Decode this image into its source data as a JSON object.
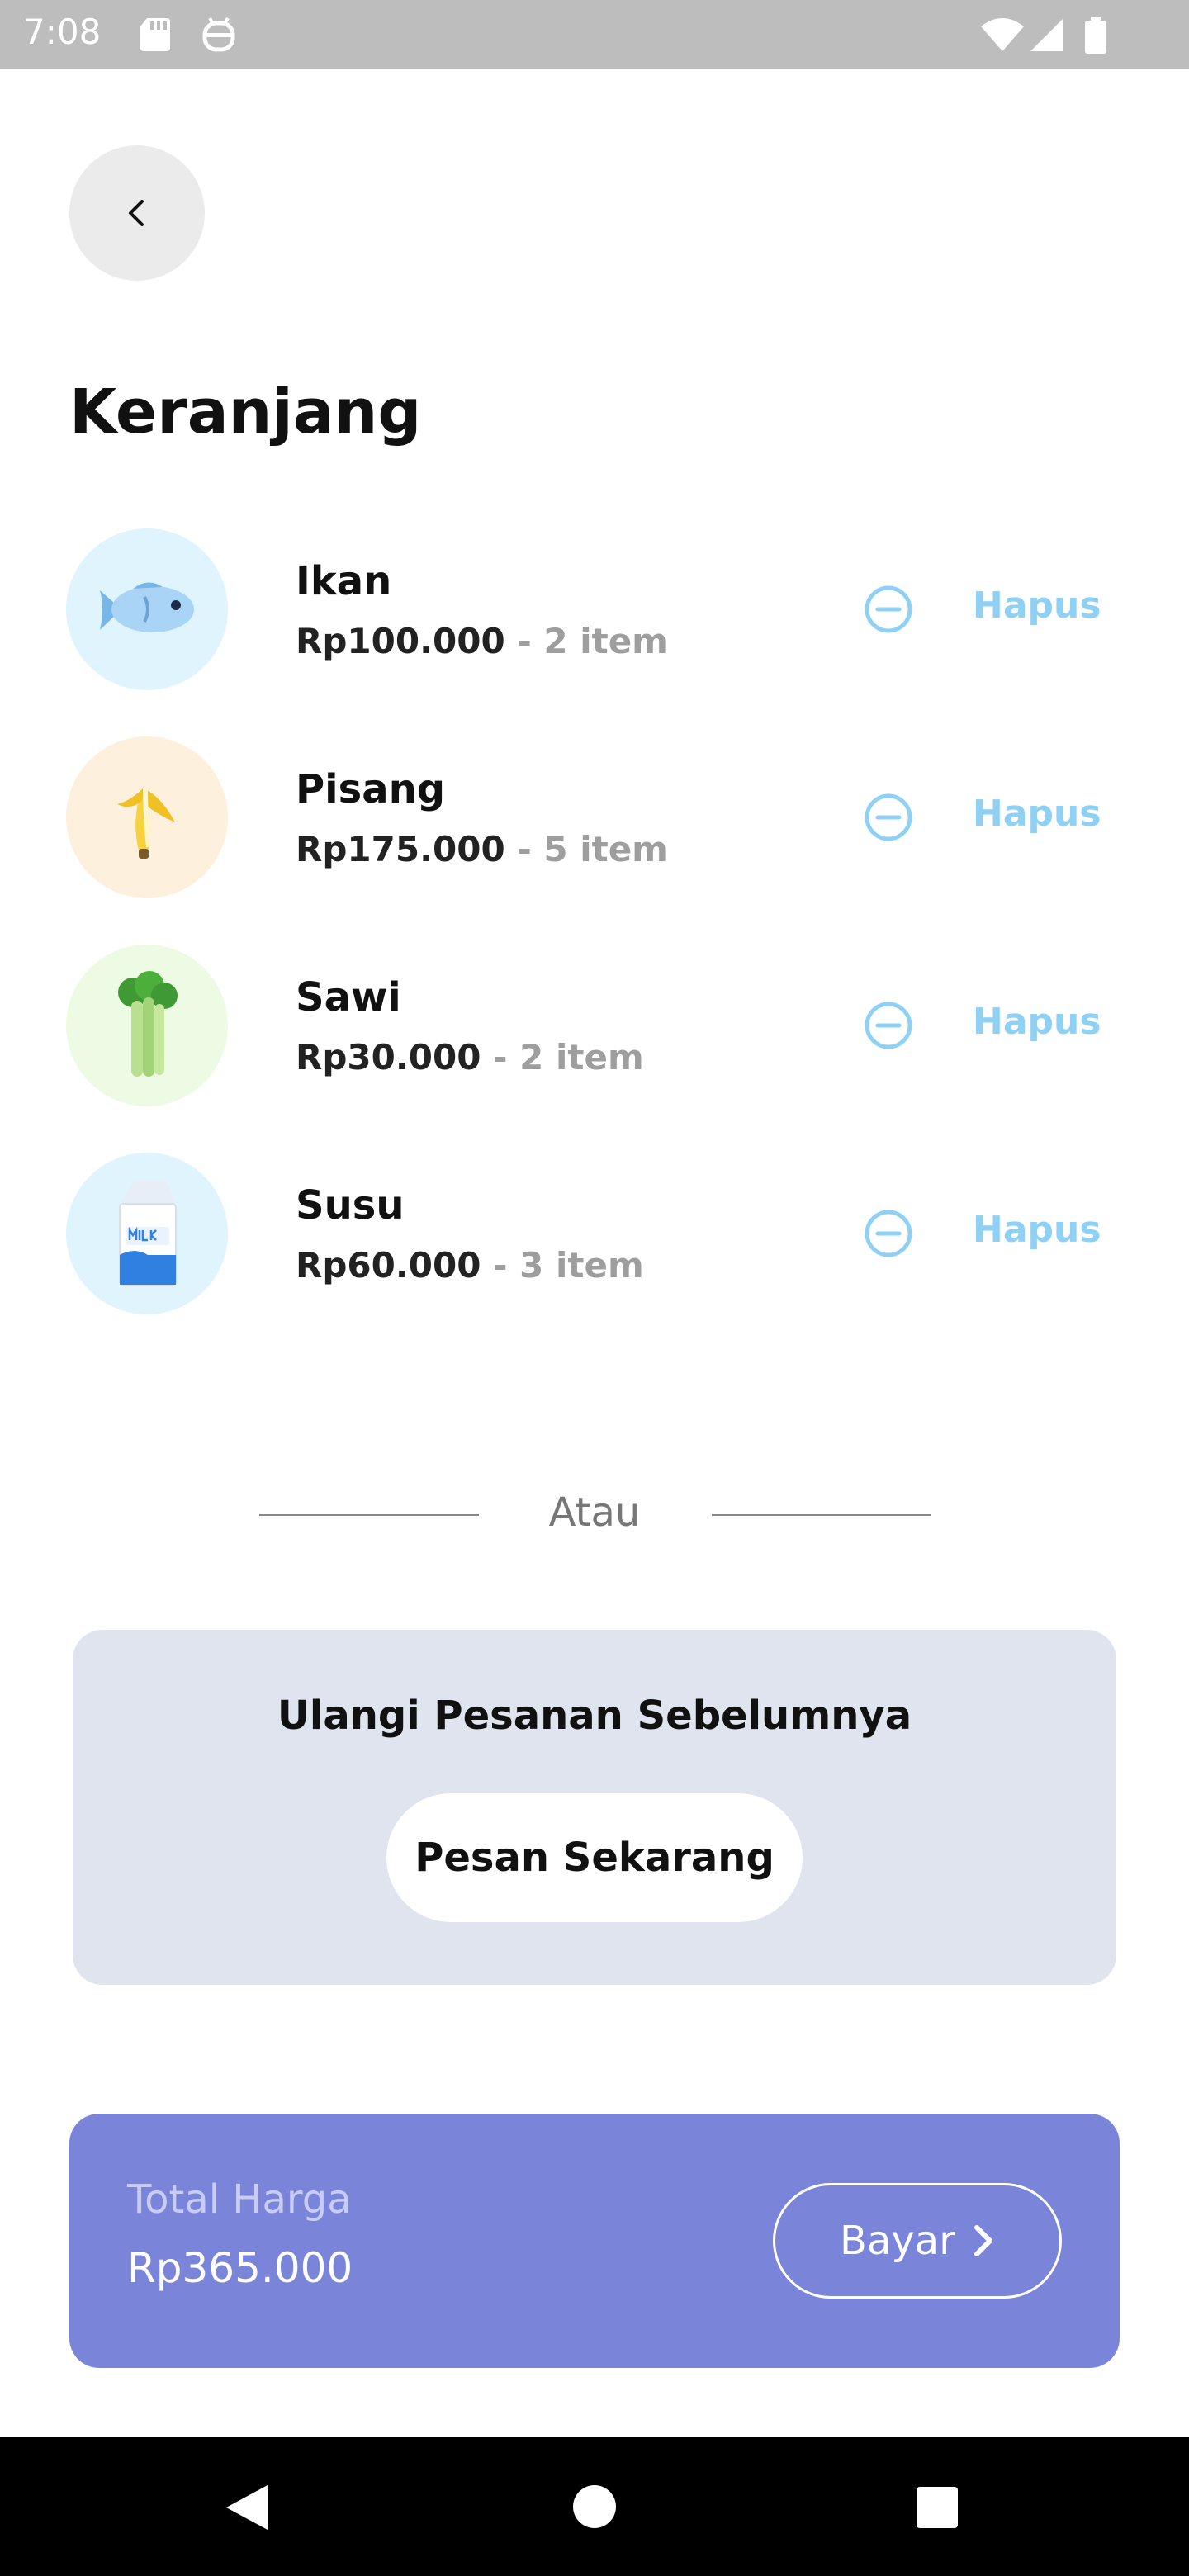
{
  "status_bar": {
    "time": "7:08"
  },
  "header": {
    "title": "Keranjang"
  },
  "cart": {
    "items": [
      {
        "name": "Ikan",
        "price": "Rp100.000",
        "qty": " - 2 item",
        "remove_label": "Hapus",
        "icon": "fish-icon",
        "bg": "#dff4fd"
      },
      {
        "name": "Pisang",
        "price": "Rp175.000",
        "qty": " - 5 item",
        "remove_label": "Hapus",
        "icon": "banana-icon",
        "bg": "#fdf0dc"
      },
      {
        "name": "Sawi",
        "price": "Rp30.000",
        "qty": " - 2 item",
        "remove_label": "Hapus",
        "icon": "celery-icon",
        "bg": "#eefbe4"
      },
      {
        "name": "Susu",
        "price": "Rp60.000",
        "qty": " - 3 item",
        "remove_label": "Hapus",
        "icon": "milk-carton-icon",
        "bg": "#dff4fd"
      }
    ]
  },
  "divider": {
    "label": "Atau"
  },
  "reorder": {
    "title": "Ulangi Pesanan Sebelumnya",
    "button_label": "Pesan Sekarang"
  },
  "total": {
    "label": "Total Harga",
    "value": "Rp365.000",
    "pay_label": "Bayar"
  },
  "colors": {
    "accent": "#7a84d9",
    "remove": "#8fd0f5",
    "card_bg": "#dfe4ee"
  }
}
